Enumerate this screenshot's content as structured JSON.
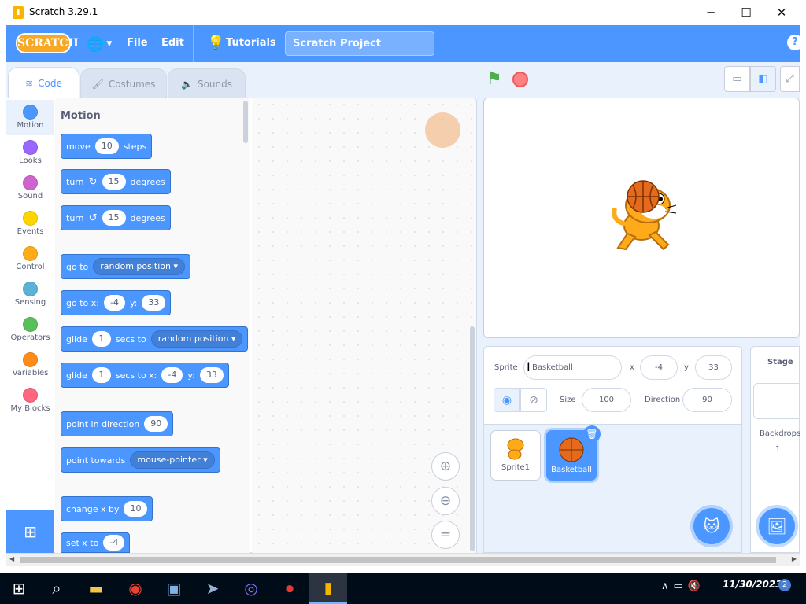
{
  "window": {
    "title": "Scratch 3.29.1",
    "minimize": "─",
    "maximize": "☐",
    "close": "✕"
  },
  "menubar": {
    "logo": "SCRATCH",
    "file": "File",
    "edit": "Edit",
    "tutorials": "Tutorials",
    "project_title": "Scratch Project",
    "help": "?"
  },
  "tabs": {
    "code": "Code",
    "costumes": "Costumes",
    "sounds": "Sounds"
  },
  "categories": [
    {
      "label": "Motion",
      "color": "#4c97ff"
    },
    {
      "label": "Looks",
      "color": "#9966ff"
    },
    {
      "label": "Sound",
      "color": "#cf63cf"
    },
    {
      "label": "Events",
      "color": "#ffd500"
    },
    {
      "label": "Control",
      "color": "#ffab19"
    },
    {
      "label": "Sensing",
      "color": "#5cb1d6"
    },
    {
      "label": "Operators",
      "color": "#59c059"
    },
    {
      "label": "Variables",
      "color": "#ff8c1a"
    },
    {
      "label": "My Blocks",
      "color": "#ff6680"
    }
  ],
  "palette": {
    "title": "Motion",
    "move": {
      "a": "move",
      "v": "10",
      "b": "steps"
    },
    "turn_right": {
      "a": "turn",
      "v": "15",
      "b": "degrees"
    },
    "turn_left": {
      "a": "turn",
      "v": "15",
      "b": "degrees"
    },
    "goto": {
      "a": "go to",
      "dd": "random position ▾"
    },
    "goto_xy": {
      "a": "go to x:",
      "x": "-4",
      "b": "y:",
      "y": "33"
    },
    "glide": {
      "a": "glide",
      "v": "1",
      "b": "secs to",
      "dd": "random position ▾"
    },
    "glide_xy": {
      "a": "glide",
      "v": "1",
      "b": "secs to x:",
      "x": "-4",
      "c": "y:",
      "y": "33"
    },
    "point_dir": {
      "a": "point in direction",
      "v": "90"
    },
    "point_towards": {
      "a": "point towards",
      "dd": "mouse-pointer ▾"
    },
    "change_x": {
      "a": "change x by",
      "v": "10"
    },
    "set_x": {
      "a": "set x to",
      "v": "-4"
    }
  },
  "zoom": {
    "in": "⊕",
    "out": "⊖",
    "reset": "="
  },
  "sprite_info": {
    "sprite_label": "Sprite",
    "sprite_name": "Basketball",
    "x_label": "x",
    "x": "-4",
    "y_label": "y",
    "y": "33",
    "size_label": "Size",
    "size": "100",
    "direction_label": "Direction",
    "direction": "90"
  },
  "sprites": [
    {
      "name": "Sprite1"
    },
    {
      "name": "Basketball"
    }
  ],
  "stage_panel": {
    "title": "Stage",
    "backdrops_label": "Backdrops",
    "backdrops_count": "1"
  },
  "taskbar": {
    "time": "11/30/2023",
    "notifications": "2"
  }
}
